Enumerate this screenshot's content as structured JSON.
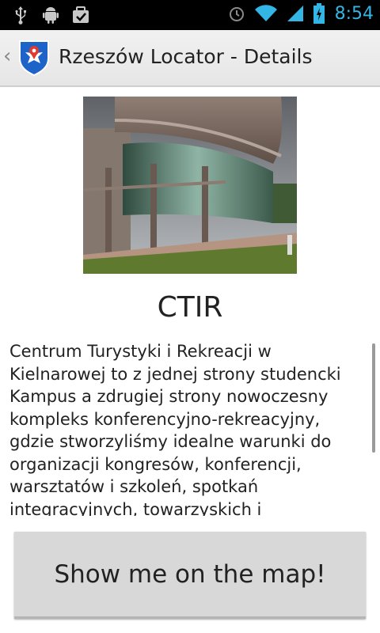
{
  "status_bar": {
    "time": "8:54",
    "icons_left": [
      "usb-icon",
      "android-debug-icon",
      "task-check-icon"
    ],
    "icons_right": [
      "alarm-icon",
      "wifi-icon",
      "signal-icon",
      "battery-icon"
    ]
  },
  "action_bar": {
    "title": "Rzeszów Locator - Details",
    "icon": "rzeszow-coat-of-arms-icon"
  },
  "place": {
    "name": "CTIR",
    "image": "ctir-building-photo",
    "description": "Centrum Turystyki i Rekreacji w Kielnarowej to z jednej strony studencki Kampus a zdrugiej strony  nowoczesny kompleks konferencyjno-rekreacyjny, gdzie stworzyliśmy idealne warunki do organizacji kongresów, konferencji, warsztatów i szkoleń, spotkań integracyjnych, towarzyskich i"
  },
  "map_button": {
    "label": "Show me on the map!"
  },
  "colors": {
    "accent": "#33b5e5",
    "statusbar_bg": "#000000",
    "actionbar_bg": "#ececec",
    "button_bg": "#d8d8d8"
  }
}
